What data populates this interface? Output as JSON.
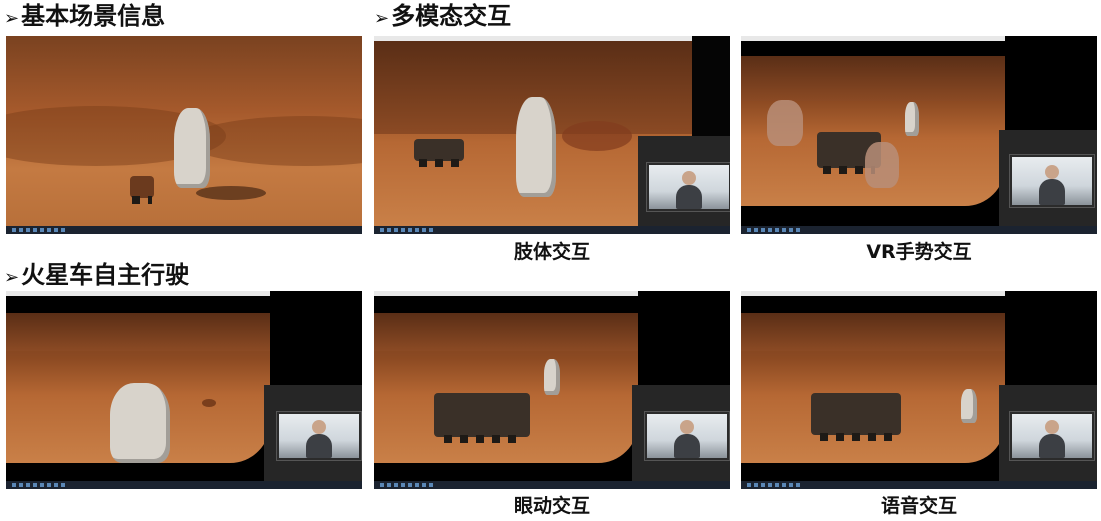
{
  "headings": {
    "basic_scene": "基本场景信息",
    "multimodal": "多模态交互",
    "autonomous_driving": "火星车自主行驶"
  },
  "arrow_glyph": "➢",
  "captions": {
    "body": "肢体交互",
    "vr_gesture": "VR手势交互",
    "eye": "眼动交互",
    "voice": "语音交互"
  },
  "colors": {
    "mars_sand": "#c98048",
    "mars_sky": "#5a2e16",
    "taskbar": "#1b2330",
    "text": "#111111"
  },
  "icons": [
    "arrow-bullet-icon"
  ]
}
